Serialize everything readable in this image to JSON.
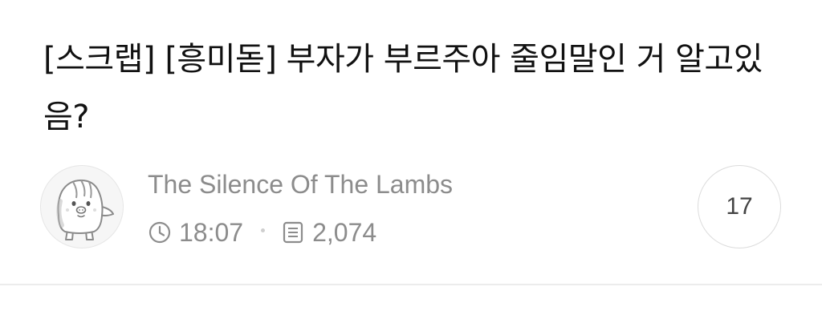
{
  "post": {
    "title": "[스크랩] [흥미돋] 부자가 부르주아 줄임말인 거 알고있음?",
    "author": "The Silence Of The Lambs",
    "time": "18:07",
    "views": "2,074",
    "comment_count": "17"
  },
  "icons": {
    "time": "clock-icon",
    "views": "document-lines-icon",
    "avatar": "penguin-mascot-icon"
  },
  "colors": {
    "title_text": "#111111",
    "meta_text": "#8c8c8c",
    "divider": "#ececec"
  }
}
